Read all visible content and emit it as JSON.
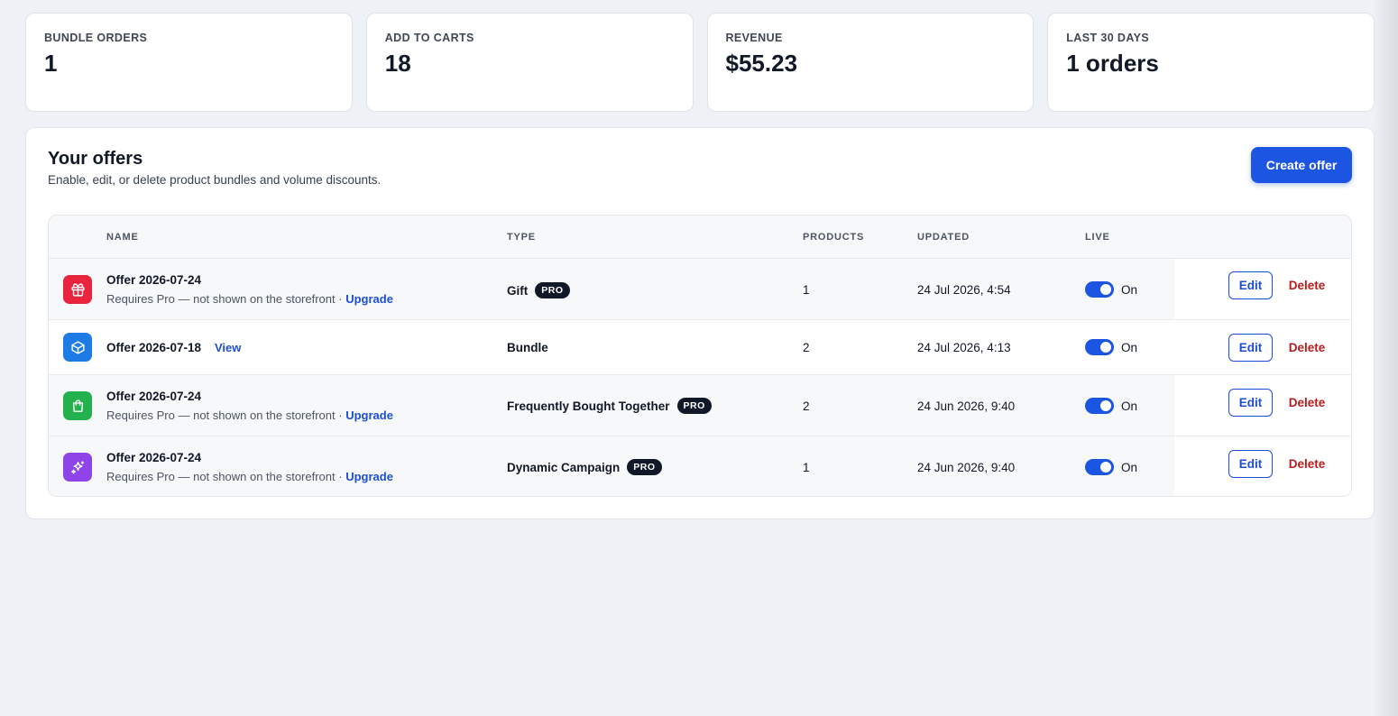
{
  "stats": [
    {
      "label": "BUNDLE ORDERS",
      "value": "1"
    },
    {
      "label": "ADD TO CARTS",
      "value": "18"
    },
    {
      "label": "REVENUE",
      "value": "$55.23"
    },
    {
      "label": "LAST 30 DAYS",
      "value": "1 orders"
    }
  ],
  "offers": {
    "title": "Your offers",
    "subtitle": "Enable, edit, or delete product bundles and volume discounts.",
    "create_label": "Create offer",
    "columns": {
      "name": "NAME",
      "type": "TYPE",
      "products": "PRODUCTS",
      "updated": "UPDATED",
      "live": "LIVE"
    },
    "rows": [
      {
        "icon": "gift-icon",
        "icon_color": "#e8243f",
        "name": "Offer 2026-07-24",
        "note": "Requires Pro — not shown on the storefront · ",
        "note_link": "Upgrade",
        "type": "Gift",
        "badge": "PRO",
        "products": "1",
        "updated": "24 Jul 2026, 4:54",
        "live": "On",
        "edit": "Edit",
        "delete": "Delete"
      },
      {
        "icon": "box-icon",
        "icon_color": "#1e7be6",
        "name": "Offer 2026-07-18",
        "view_link": "View",
        "type": "Bundle",
        "products": "2",
        "updated": "24 Jul 2026, 4:13",
        "live": "On",
        "edit": "Edit",
        "delete": "Delete"
      },
      {
        "icon": "shopping-bag-icon",
        "icon_color": "#22b14c",
        "name": "Offer 2026-07-24",
        "note": "Requires Pro — not shown on the storefront · ",
        "note_link": "Upgrade",
        "type": "Frequently Bought Together",
        "badge": "PRO",
        "products": "2",
        "updated": "24 Jun 2026, 9:40",
        "live": "On",
        "edit": "Edit",
        "delete": "Delete"
      },
      {
        "icon": "sparkles-icon",
        "icon_color": "#8e44e8",
        "name": "Offer 2026-07-24",
        "note": "Requires Pro — not shown on the storefront · ",
        "note_link": "Upgrade",
        "type": "Dynamic Campaign",
        "badge": "PRO",
        "products": "1",
        "updated": "24 Jun 2026, 9:40",
        "live": "On",
        "edit": "Edit",
        "delete": "Delete"
      }
    ]
  },
  "colors": {
    "accent": "#1d55e3",
    "danger": "#b91c1c",
    "badge": "#111827"
  }
}
